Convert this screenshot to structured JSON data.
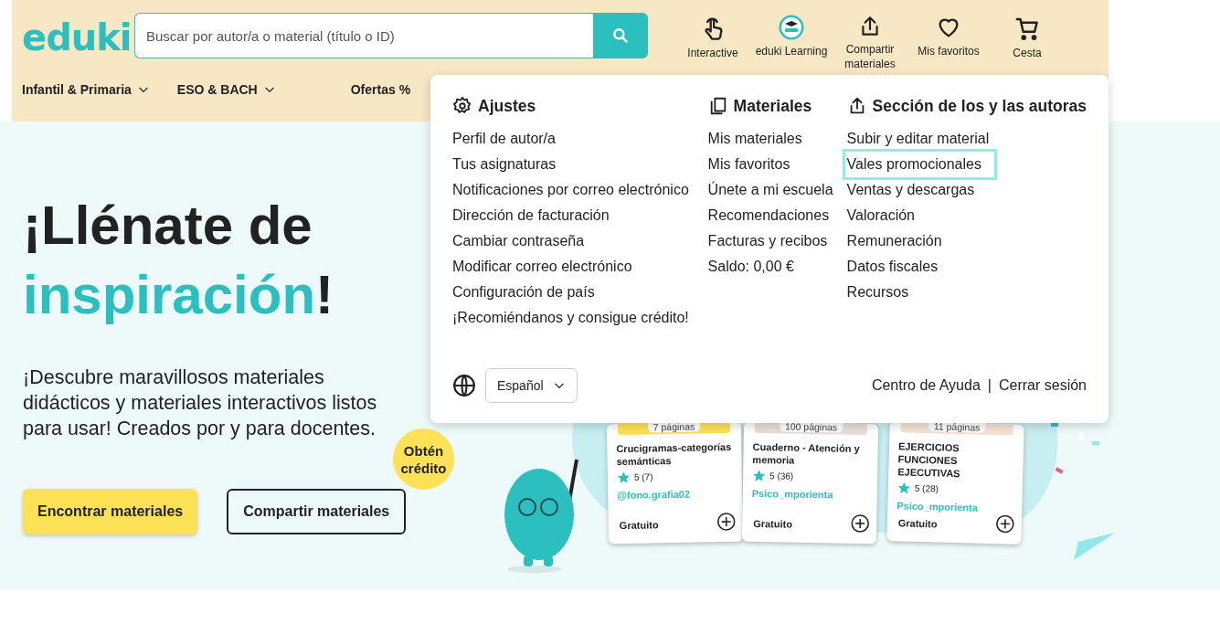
{
  "header": {
    "logo": "eduki",
    "search": {
      "placeholder": "Buscar por autor/a o material (título o ID)"
    },
    "actions": [
      {
        "kind": "interactive",
        "label": "Interactive"
      },
      {
        "kind": "learning",
        "label": "eduki Learning"
      },
      {
        "kind": "share",
        "label": "Compartir materiales"
      },
      {
        "kind": "favorites",
        "label": "Mis favoritos"
      },
      {
        "kind": "cart",
        "label": "Cesta"
      }
    ],
    "nav": [
      {
        "label": "Infantil & Primaria",
        "dropdown": true
      },
      {
        "label": "ESO & BACH",
        "dropdown": true
      },
      {
        "label": "Ofertas %",
        "dropdown": false
      }
    ]
  },
  "hero": {
    "title": [
      {
        "text": "¡Llénate de",
        "accent": false
      },
      {
        "text": "inspiración",
        "accent": true
      },
      {
        "text": "!",
        "accent": false
      }
    ],
    "subtitle": "¡Descubre maravillosos materiales didácticos y materiales interactivos listos para usar! Creados por y para docentes.",
    "buttons": [
      {
        "kind": "primary",
        "label": "Encontrar materiales"
      },
      {
        "kind": "outline",
        "label": "Compartir materiales"
      }
    ],
    "badge": "Obtén crédito",
    "cards": [
      {
        "pages": "7 páginas",
        "title": "Crucigramas-categorías semánticas",
        "rating": "5 (7)",
        "author": "@fono.grafia02",
        "price": "Gratuito"
      },
      {
        "pages": "100 páginas",
        "title": "Cuaderno - Atención y memoria",
        "rating": "5 (36)",
        "author": "Psico_mporienta",
        "price": "Gratuito"
      },
      {
        "pages": "11 páginas",
        "title": "EJERCICIOS FUNCIONES EJECUTIVAS",
        "rating": "5 (28)",
        "author": "Psico_mporienta",
        "price": "Gratuito"
      }
    ]
  },
  "menu": {
    "columns": [
      {
        "kind": "settings",
        "heading": "Ajustes",
        "items": [
          {
            "label": "Perfil de autor/a",
            "focused": false
          },
          {
            "label": "Tus asignaturas",
            "focused": false
          },
          {
            "label": "Notificaciones por correo electrónico",
            "focused": false
          },
          {
            "label": "Dirección de facturación",
            "focused": false
          },
          {
            "label": "Cambiar contraseña",
            "focused": false
          },
          {
            "label": "Modificar correo electrónico",
            "focused": false
          },
          {
            "label": "Configuración de país",
            "focused": false
          },
          {
            "label": "¡Recomiéndanos y consigue crédito!",
            "focused": false
          }
        ]
      },
      {
        "kind": "materials",
        "heading": "Materiales",
        "items": [
          {
            "label": "Mis materiales",
            "focused": false
          },
          {
            "label": "Mis favoritos",
            "focused": false
          },
          {
            "label": "Únete a mi escuela",
            "focused": false
          },
          {
            "label": "Recomendaciones",
            "focused": false
          },
          {
            "label": "Facturas y recibos",
            "focused": false
          },
          {
            "label": "Saldo: 0,00 €",
            "focused": false
          }
        ]
      },
      {
        "kind": "share",
        "heading": "Sección de los y las autoras",
        "items": [
          {
            "label": "Subir y editar material",
            "focused": false
          },
          {
            "label": "Vales promocionales",
            "focused": true
          },
          {
            "label": "Ventas y descargas",
            "focused": false
          },
          {
            "label": "Valoración",
            "focused": false
          },
          {
            "label": "Remuneración",
            "focused": false
          },
          {
            "label": "Datos fiscales",
            "focused": false
          },
          {
            "label": "Recursos",
            "focused": false
          }
        ]
      }
    ],
    "language": "Español",
    "links": [
      "Centro de Ayuda",
      "Cerrar sesión"
    ],
    "separator": "|"
  }
}
